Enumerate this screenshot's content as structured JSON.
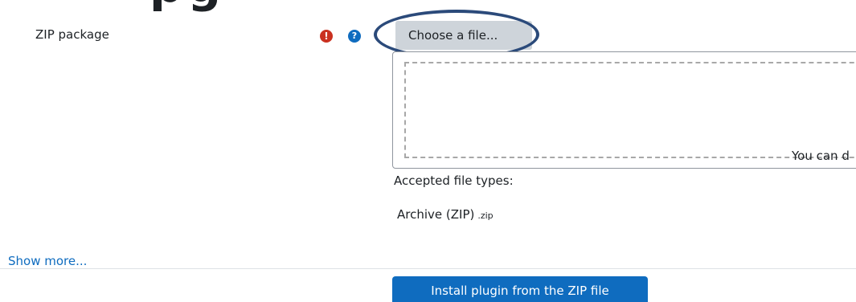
{
  "form": {
    "heading_fragment": "pg",
    "zip_field_label": "ZIP package",
    "required_icon_glyph": "!",
    "help_icon_glyph": "?",
    "choose_file_label": "Choose a file...",
    "drop_hint": "You can d",
    "accepted_types_label": "Accepted file types:",
    "accepted_types": [
      {
        "name": "Archive (ZIP)",
        "ext": ".zip"
      }
    ],
    "show_more_label": "Show more...",
    "install_button_label": "Install plugin from the ZIP file"
  },
  "icons": {
    "required": "exclamation-circle-icon",
    "help": "question-circle-icon"
  },
  "colors": {
    "primary": "#0f6cbf",
    "required": "#ca3120",
    "secondary_button": "#ced4da",
    "annotation_ellipse": "#2b4a7a"
  }
}
